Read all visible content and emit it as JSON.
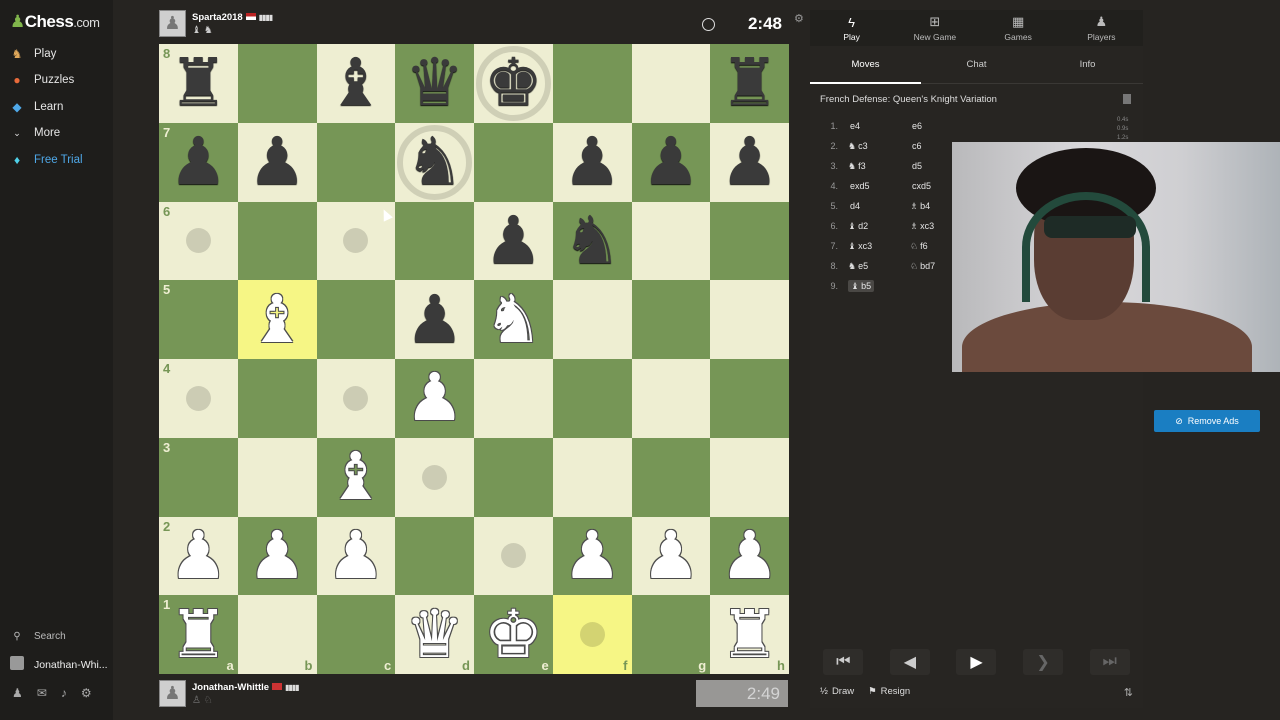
{
  "sidebar": {
    "logo_main": "Chess",
    "logo_suffix": ".com",
    "items": [
      {
        "label": "Play",
        "icon": "play-icon"
      },
      {
        "label": "Puzzles",
        "icon": "puzzle-icon"
      },
      {
        "label": "Learn",
        "icon": "learn-icon"
      },
      {
        "label": "More",
        "icon": "chevron-down-icon"
      },
      {
        "label": "Free Trial",
        "icon": "diamond-icon"
      }
    ],
    "search_label": "Search",
    "user_label": "Jonathan-Whi..."
  },
  "top_player": {
    "name": "Sparta2018",
    "clock": "2:48",
    "captured": "♝ ♞"
  },
  "bottom_player": {
    "name": "Jonathan-Whittle",
    "clock": "2:49"
  },
  "board": {
    "ranks": [
      "8",
      "7",
      "6",
      "5",
      "4",
      "3",
      "2",
      "1"
    ],
    "files": [
      "a",
      "b",
      "c",
      "d",
      "e",
      "f",
      "g",
      "h"
    ],
    "position": [
      [
        "bR",
        "",
        "bB",
        "bQ",
        "bK",
        "",
        "",
        "bR"
      ],
      [
        "bP",
        "bP",
        "",
        "bN",
        "",
        "bP",
        "bP",
        "bP"
      ],
      [
        "",
        "",
        "",
        "",
        "bP",
        "bN",
        "",
        ""
      ],
      [
        "",
        "wB",
        "",
        "bP",
        "wN",
        "",
        "",
        ""
      ],
      [
        "",
        "",
        "",
        "wP",
        "",
        "",
        "",
        ""
      ],
      [
        "",
        "",
        "wB",
        "",
        "",
        "",
        "",
        ""
      ],
      [
        "wP",
        "wP",
        "wP",
        "",
        "",
        "wP",
        "wP",
        "wP"
      ],
      [
        "wR",
        "",
        "",
        "wQ",
        "wK",
        "",
        "",
        "wR"
      ]
    ],
    "highlights": [
      "b5",
      "f1"
    ],
    "move_dots": [
      "a6",
      "c6",
      "a4",
      "c4",
      "d3",
      "e2",
      "f1"
    ],
    "rings": [
      "e8",
      "d7"
    ]
  },
  "panel": {
    "tabs": [
      {
        "label": "Play",
        "icon": "lightning-icon"
      },
      {
        "label": "New Game",
        "icon": "plus-square-icon"
      },
      {
        "label": "Games",
        "icon": "board-icon"
      },
      {
        "label": "Players",
        "icon": "players-icon"
      }
    ],
    "subtabs": [
      "Moves",
      "Chat",
      "Info"
    ],
    "opening": "French Defense: Queen's Knight Variation",
    "moves": [
      {
        "n": "1.",
        "w": "e4",
        "wi": "",
        "b": "e6",
        "bi": ""
      },
      {
        "n": "2.",
        "w": "c3",
        "wi": "♞",
        "b": "c6",
        "bi": ""
      },
      {
        "n": "3.",
        "w": "f3",
        "wi": "♞",
        "b": "d5",
        "bi": ""
      },
      {
        "n": "4.",
        "w": "exd5",
        "wi": "",
        "b": "cxd5",
        "bi": ""
      },
      {
        "n": "5.",
        "w": "d4",
        "wi": "",
        "b": "b4",
        "bi": "♗"
      },
      {
        "n": "6.",
        "w": "d2",
        "wi": "♝",
        "b": "xc3",
        "bi": "♗"
      },
      {
        "n": "7.",
        "w": "xc3",
        "wi": "♝",
        "b": "f6",
        "bi": "♘"
      },
      {
        "n": "8.",
        "w": "e5",
        "wi": "♞",
        "b": "bd7",
        "bi": "♘"
      },
      {
        "n": "9.",
        "w": "b5",
        "wi": "♝",
        "b": "",
        "bi": ""
      }
    ],
    "move_times": [
      "0.4s",
      "0.9s",
      "1.2s"
    ],
    "draw_label": "Draw",
    "resign_label": "Resign",
    "draw_icon": "½"
  },
  "ads": {
    "remove_label": "Remove Ads"
  }
}
